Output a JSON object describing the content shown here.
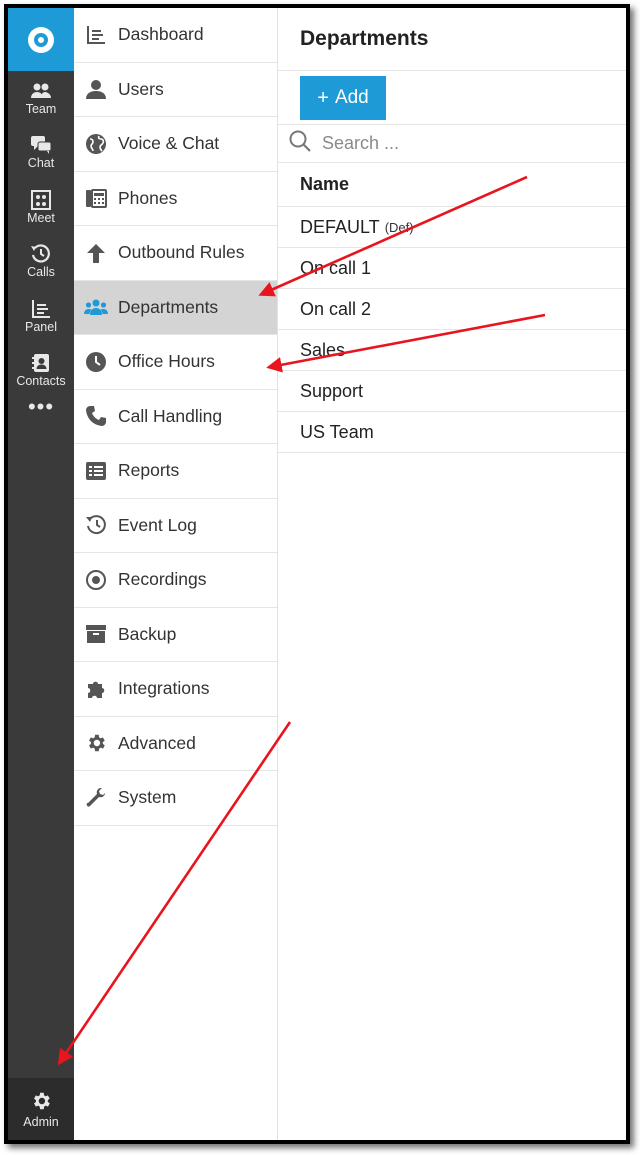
{
  "rail": {
    "items": [
      {
        "label": "Team",
        "icon": "team-icon"
      },
      {
        "label": "Chat",
        "icon": "chat-icon"
      },
      {
        "label": "Meet",
        "icon": "meet-icon"
      },
      {
        "label": "Calls",
        "icon": "calls-icon"
      },
      {
        "label": "Panel",
        "icon": "panel-icon"
      },
      {
        "label": "Contacts",
        "icon": "contacts-icon"
      }
    ],
    "more": "•••",
    "admin_label": "Admin"
  },
  "nav": {
    "items": [
      {
        "label": "Dashboard",
        "icon": "dashboard-icon"
      },
      {
        "label": "Users",
        "icon": "user-icon"
      },
      {
        "label": "Voice & Chat",
        "icon": "globe-icon"
      },
      {
        "label": "Phones",
        "icon": "phone-device-icon"
      },
      {
        "label": "Outbound Rules",
        "icon": "arrow-up-icon"
      },
      {
        "label": "Departments",
        "icon": "departments-icon",
        "active": true
      },
      {
        "label": "Office Hours",
        "icon": "clock-icon"
      },
      {
        "label": "Call Handling",
        "icon": "handset-icon"
      },
      {
        "label": "Reports",
        "icon": "reports-icon"
      },
      {
        "label": "Event Log",
        "icon": "history-icon"
      },
      {
        "label": "Recordings",
        "icon": "record-icon"
      },
      {
        "label": "Backup",
        "icon": "archive-icon"
      },
      {
        "label": "Integrations",
        "icon": "puzzle-icon"
      },
      {
        "label": "Advanced",
        "icon": "gear-icon"
      },
      {
        "label": "System",
        "icon": "wrench-icon"
      }
    ]
  },
  "main": {
    "title": "Departments",
    "add_label": "Add",
    "search_placeholder": "Search ...",
    "column_header": "Name",
    "rows": [
      {
        "name": "DEFAULT",
        "badge": "(Def)"
      },
      {
        "name": "On call 1"
      },
      {
        "name": "On call 2"
      },
      {
        "name": "Sales"
      },
      {
        "name": "Support"
      },
      {
        "name": "US Team"
      }
    ]
  },
  "colors": {
    "accent": "#1e9bd7",
    "rail_bg": "#3a3a3a",
    "active_nav_bg": "#d4d4d4",
    "annotation_arrow": "#e8141e"
  }
}
